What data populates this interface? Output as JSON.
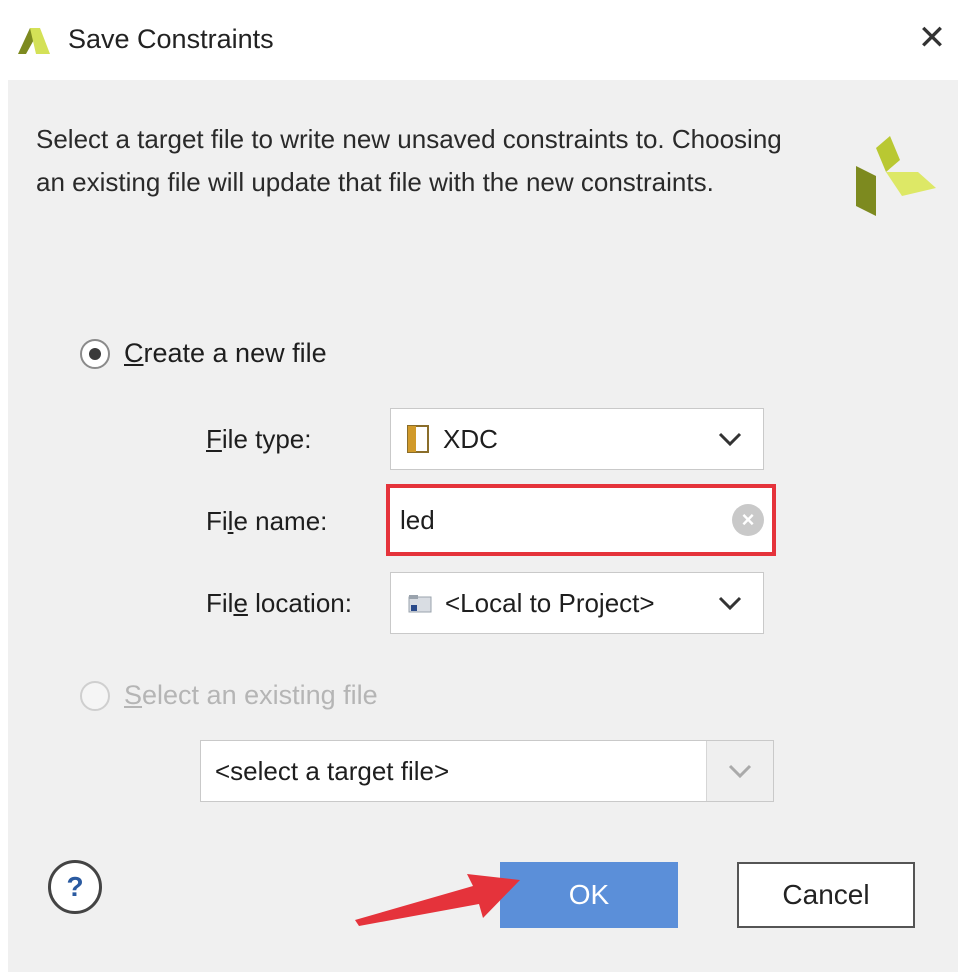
{
  "window": {
    "title": "Save Constraints",
    "close_symbol": "✕"
  },
  "description": "Select a target file to write new unsaved constraints to. Choosing an existing file will update that file with the new constraints.",
  "create_option": {
    "label_prefix": "C",
    "label_rest": "reate a new file",
    "selected": true
  },
  "file_type": {
    "label_prefix": "F",
    "label_rest": "ile type:",
    "value": "XDC",
    "icon": "xdc-file-icon"
  },
  "file_name": {
    "label_prefix": "Fi",
    "label_underline": "l",
    "label_rest": "e name:",
    "value": "led"
  },
  "file_location": {
    "label_prefix": "Fil",
    "label_underline": "e",
    "label_rest": " location:",
    "value": "<Local to Project>",
    "icon": "folder-icon"
  },
  "existing_option": {
    "label_underline": "S",
    "label_rest": "elect an existing file",
    "selected": false,
    "enabled": false
  },
  "target_select": {
    "value": "<select a target file>"
  },
  "buttons": {
    "help": "?",
    "ok": "OK",
    "cancel": "Cancel"
  },
  "colors": {
    "ok_button": "#5b8fd9",
    "highlight": "#e5333b",
    "logo_dark": "#7d8a1f",
    "logo_light": "#d4e157"
  }
}
